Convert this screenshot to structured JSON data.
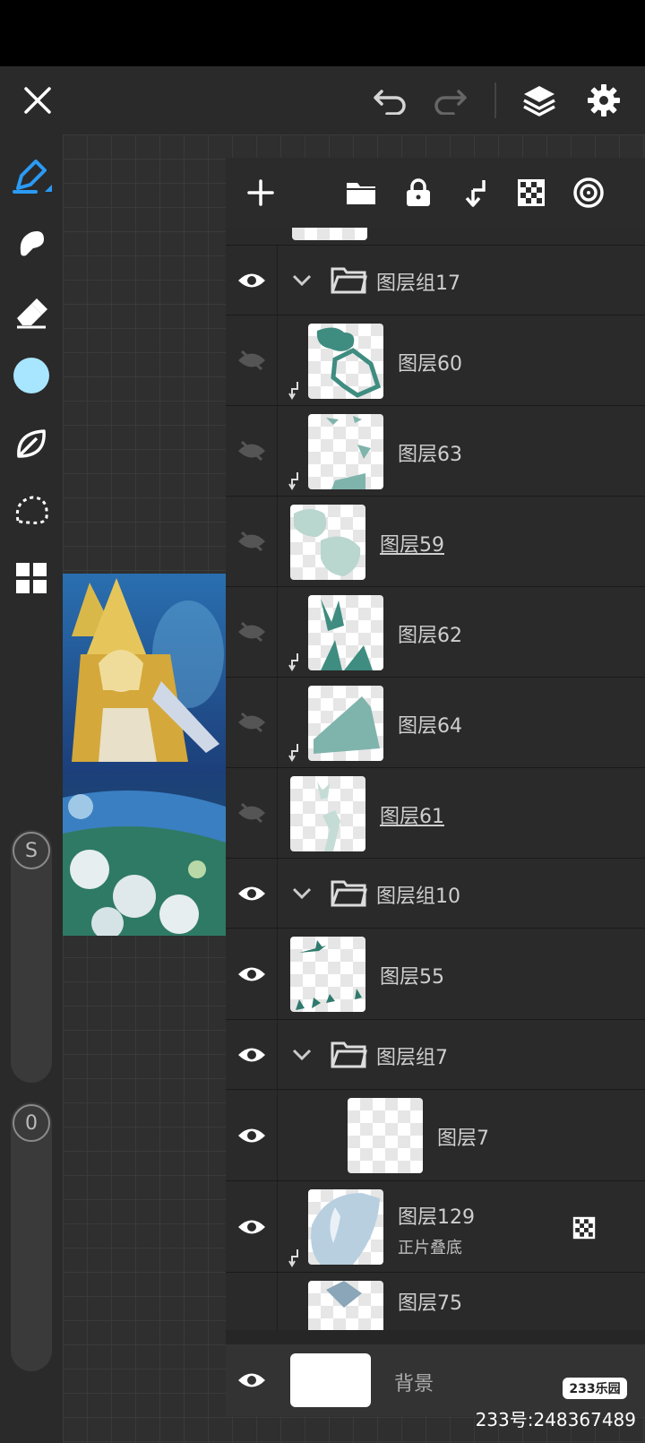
{
  "toolbar": {
    "close": "close-icon",
    "undo": "undo-icon",
    "redo": "redo-icon",
    "layers": "layers-icon",
    "settings": "gear-icon"
  },
  "sidebar": {
    "brush_color": "#a8e6ff",
    "size_label": "S",
    "opacity_label": "0"
  },
  "panel_toolbar": {
    "add": "plus-icon",
    "folder": "folder-icon",
    "lock": "lock-icon",
    "clip": "clip-down-icon",
    "alpha": "checker-icon",
    "ref": "target-icon"
  },
  "layers": [
    {
      "name": "图层组17",
      "type": "group",
      "visible": true
    },
    {
      "name": "图层60",
      "type": "layer",
      "visible": false,
      "clipped": true
    },
    {
      "name": "图层63",
      "type": "layer",
      "visible": false,
      "clipped": true
    },
    {
      "name": "图层59",
      "type": "layer",
      "visible": false,
      "underline": true
    },
    {
      "name": "图层62",
      "type": "layer",
      "visible": false,
      "clipped": true
    },
    {
      "name": "图层64",
      "type": "layer",
      "visible": false,
      "clipped": true
    },
    {
      "name": "图层61",
      "type": "layer",
      "visible": false,
      "underline": true
    },
    {
      "name": "图层组10",
      "type": "group",
      "visible": true
    },
    {
      "name": "图层55",
      "type": "layer",
      "visible": true
    },
    {
      "name": "图层组7",
      "type": "group",
      "visible": true
    },
    {
      "name": "图层7",
      "type": "layer",
      "visible": true
    },
    {
      "name": "图层129",
      "type": "layer",
      "visible": true,
      "clipped": true,
      "blend": "正片叠底"
    },
    {
      "name": "图层75",
      "type": "layer",
      "visible": true,
      "clipped": true
    }
  ],
  "background_layer": {
    "name": "背景"
  },
  "watermark": {
    "logo": "233乐园",
    "text": "233号:248367489"
  }
}
